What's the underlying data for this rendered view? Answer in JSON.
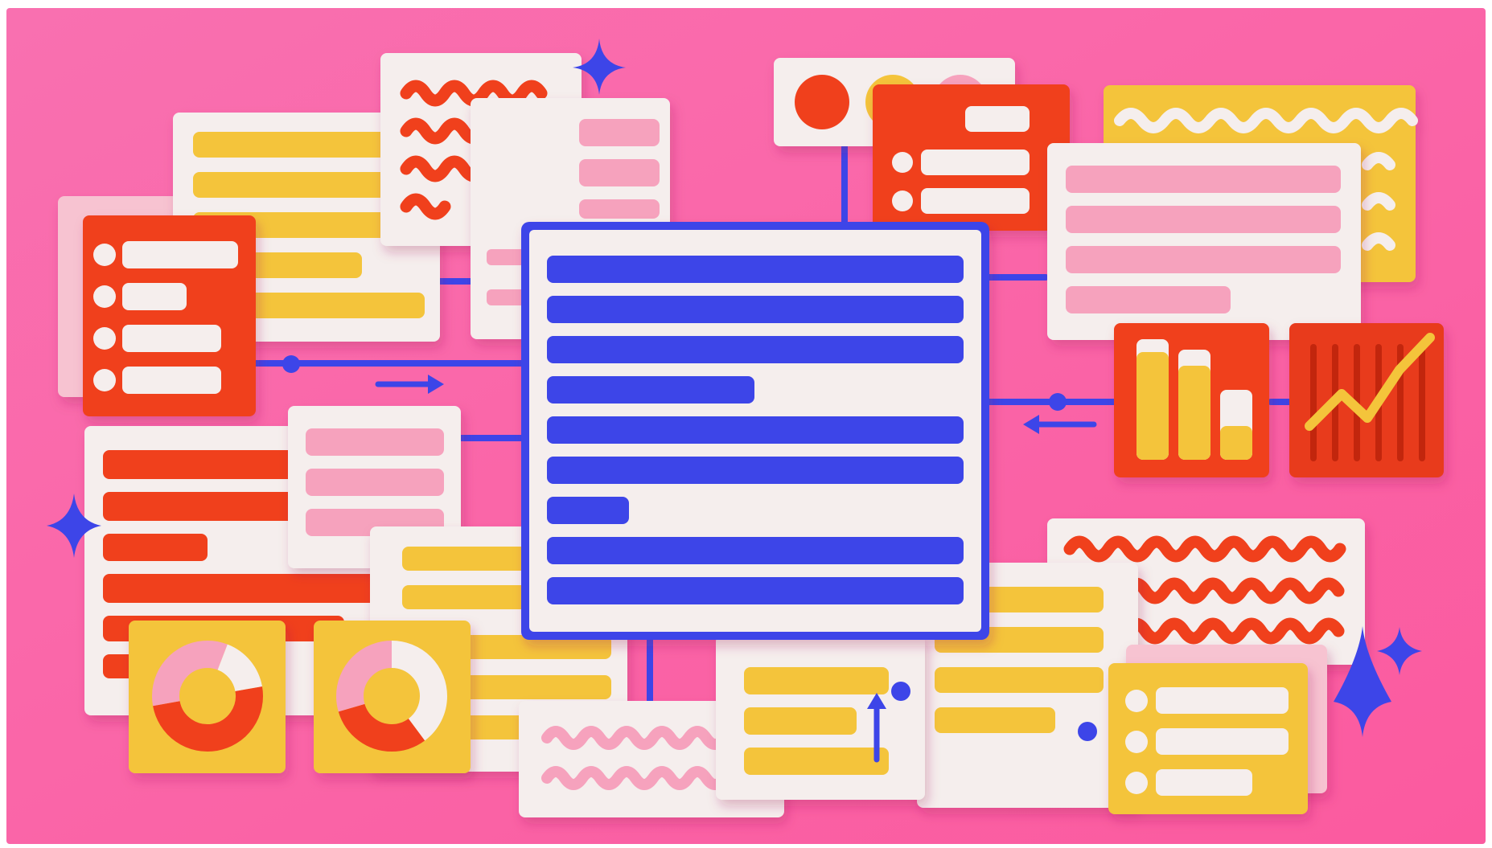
{
  "illustration": {
    "subject": "3d-data-dashboard-cards",
    "colors": {
      "background": "#fb62a6",
      "blue": "#3d45e8",
      "yellow": "#f4c43b",
      "red": "#f0401f",
      "pink": "#f6a2bd",
      "cream": "#f5eeed"
    },
    "icons": [
      "sparkle-icon",
      "arrow-right-icon",
      "arrow-left-icon",
      "arrow-up-icon",
      "bar-chart-icon",
      "line-chart-icon",
      "donut-chart-icon"
    ]
  }
}
